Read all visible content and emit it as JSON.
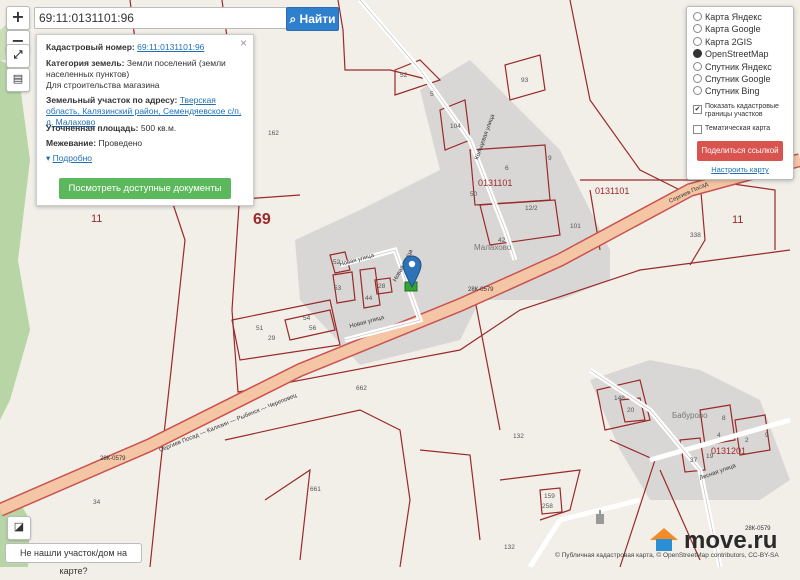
{
  "search": {
    "value": "69:11:0131101:96",
    "button_label": "Найти"
  },
  "zoom": {
    "in": "+",
    "out": "−"
  },
  "info": {
    "close": "×",
    "cad_label": "Кадастровый номер:",
    "cad_value": "69:11:0131101:96",
    "cat_label": "Категория земель:",
    "cat_value": "Земли поселений (земли населенных пунктов)",
    "cat_use": "Для строительства магазина",
    "addr_label": "Земельный участок по адресу:",
    "addr_value": "Тверская область, Калязинский район, Семендяевское с/п, д. Малахово",
    "area_label": "Уточненная площадь:",
    "area_value": "500 кв.м.",
    "survey_label": "Межевание:",
    "survey_value": "Проведено",
    "more": "Подробно",
    "docs_button": "Посмотреть доступные документы"
  },
  "layers": {
    "items": [
      {
        "label": "Карта Яндекс",
        "selected": false
      },
      {
        "label": "Карта Google",
        "selected": false
      },
      {
        "label": "Карта 2GIS",
        "selected": false
      },
      {
        "label": "OpenStreetMap",
        "selected": true
      },
      {
        "label": "Спутник Яндекс",
        "selected": false
      },
      {
        "label": "Спутник Google",
        "selected": false
      },
      {
        "label": "Спутник Bing",
        "selected": false
      }
    ],
    "show_borders": "Показать кадастровые границы участков",
    "show_borders_checked": true,
    "thematic": "Тематическая карта",
    "thematic_checked": false,
    "share": "Поделиться ссылкой",
    "configure": "Настроить карту"
  },
  "notfound": "Не нашли участок/дом на карте?",
  "copyright": "© Публичная кадастровая карта, © OpenStreetMap contributors, CC-BY-SA",
  "brand": "move.ru",
  "map": {
    "labels": {
      "q69": "69",
      "q11a": "11",
      "q11b": "11",
      "p162": "162",
      "p52": "52",
      "p5": "5",
      "p93": "93",
      "p104": "104",
      "block1": "0131101",
      "block2": "0131101",
      "block3": "0131201",
      "p338": "338",
      "p662": "662",
      "p132a": "132",
      "p132b": "132",
      "p34": "34",
      "p661": "661",
      "p148": "148",
      "p20": "20",
      "p8": "8",
      "p19": "19",
      "p37": "37",
      "p2": "2",
      "p9": "9",
      "p4": "4",
      "p51": "51",
      "p54": "54",
      "p29": "29",
      "p56": "56",
      "p53": "53",
      "p52b": "52",
      "p44": "44",
      "p28": "28",
      "p12_2": "12/2",
      "p42": "42",
      "p101": "101",
      "p6": "6",
      "p50": "50",
      "p9b": "9",
      "p159": "159",
      "p258": "258",
      "road1": "28К-0579",
      "road2": "28К-0579",
      "road3": "28К-0579",
      "hwy": "Сергиев Посад — Калязин — Рыбинск — Череповец",
      "hwy2": "Сергиев Посад",
      "street1": "Новая улица",
      "street2": "Новая улица",
      "street3": "Новая улица",
      "street4": "Кольцевая улица",
      "street5": "Лесная улица",
      "village1": "Малахово",
      "village2": "Бабурово"
    }
  }
}
